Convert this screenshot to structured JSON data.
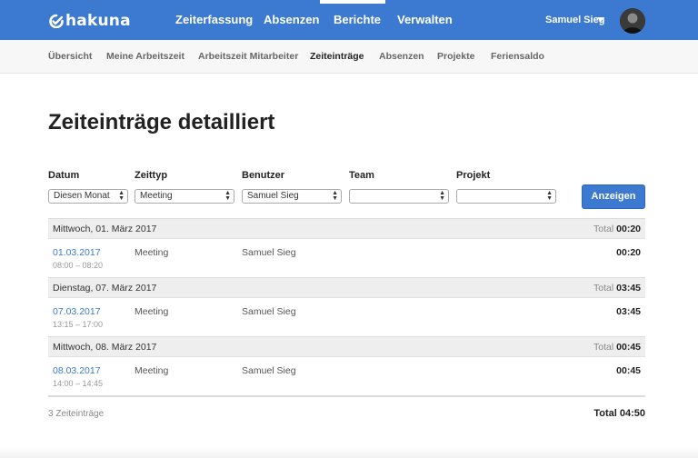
{
  "brand": {
    "logo_text": "hakuna",
    "icon": "hakuna-logo-icon"
  },
  "main_nav": [
    {
      "label": "Zeiterfassung"
    },
    {
      "label": "Absenzen"
    },
    {
      "label": "Berichte",
      "active": true
    },
    {
      "label": "Verwalten"
    }
  ],
  "user": {
    "name": "Samuel Sieg",
    "caret_icon": "caret-down-icon"
  },
  "sub_nav": [
    {
      "label": "Übersicht"
    },
    {
      "label": "Meine Arbeitszeit"
    },
    {
      "label": "Arbeitszeit Mitarbeiter"
    },
    {
      "label": "Zeiteinträge",
      "active": true
    },
    {
      "label": "Absenzen"
    },
    {
      "label": "Projekte"
    },
    {
      "label": "Feriensaldo"
    }
  ],
  "page": {
    "title": "Zeiteinträge detailliert"
  },
  "filters": {
    "datum": {
      "label": "Datum",
      "value": "Diesen Monat"
    },
    "zeittyp": {
      "label": "Zeittyp",
      "value": "Meeting"
    },
    "benutzer": {
      "label": "Benutzer",
      "value": "Samuel Sieg"
    },
    "team": {
      "label": "Team",
      "value": ""
    },
    "projekt": {
      "label": "Projekt",
      "value": ""
    },
    "submit_label": "Anzeigen"
  },
  "days": [
    {
      "title": "Mittwoch, 01. März 2017",
      "total_label": "Total",
      "total": "00:20",
      "entry": {
        "date": "01.03.2017",
        "time": "08:00 – 08:20",
        "type": "Meeting",
        "user": "Samuel Sieg",
        "duration": "00:20"
      }
    },
    {
      "title": "Dienstag, 07. März 2017",
      "total_label": "Total",
      "total": "03:45",
      "entry": {
        "date": "07.03.2017",
        "time": "13:15 – 17:00",
        "type": "Meeting",
        "user": "Samuel Sieg",
        "duration": "03:45"
      }
    },
    {
      "title": "Mittwoch, 08. März 2017",
      "total_label": "Total",
      "total": "00:45",
      "entry": {
        "date": "08.03.2017",
        "time": "14:00 – 14:45",
        "type": "Meeting",
        "user": "Samuel Sieg",
        "duration": "00:45"
      }
    }
  ],
  "summary": {
    "count": "3 Zeiteinträge",
    "total": "Total 04:50"
  },
  "colors": {
    "primary": "#3b7ad0",
    "link": "#3b7ad0",
    "row_header": "#eeeeee",
    "subnav_bg": "#f7f7f7"
  }
}
